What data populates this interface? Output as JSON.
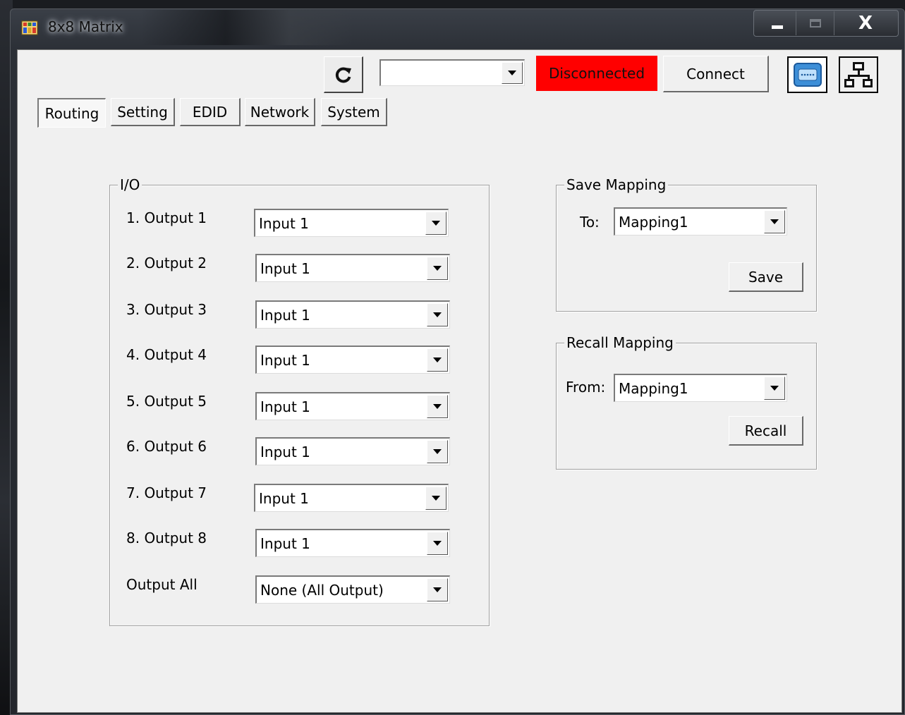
{
  "window": {
    "title": "8x8 Matrix",
    "icons": {
      "app": "matrix-app-icon",
      "minimize": "minimize-icon",
      "maximize": "maximize-icon",
      "close": "close-icon"
    },
    "close_glyph": "X"
  },
  "toolbar": {
    "refresh_icon": "refresh-icon",
    "port_value": "",
    "status_text": "Disconnected",
    "status_color": "#ff0000",
    "connect_label": "Connect",
    "serial_icon": "serial-port-icon",
    "network_icon": "network-icon"
  },
  "tabs": [
    {
      "label": "Routing",
      "selected": true
    },
    {
      "label": "Setting",
      "selected": false
    },
    {
      "label": "EDID",
      "selected": false
    },
    {
      "label": "Network",
      "selected": false
    },
    {
      "label": "System",
      "selected": false
    }
  ],
  "io": {
    "legend": "I/O",
    "rows": [
      {
        "label": "1.  Output 1",
        "value": "Input 1"
      },
      {
        "label": "2.  Output 2",
        "value": "Input 1"
      },
      {
        "label": "3.  Output 3",
        "value": "Input 1"
      },
      {
        "label": "4.  Output 4",
        "value": "Input 1"
      },
      {
        "label": "5.  Output 5",
        "value": "Input 1"
      },
      {
        "label": "6.  Output 6",
        "value": "Input 1"
      },
      {
        "label": "7.  Output 7",
        "value": "Input 1"
      },
      {
        "label": "8.  Output 8",
        "value": "Input 1"
      },
      {
        "label": "Output All",
        "value": "None (All Output)"
      }
    ]
  },
  "save_mapping": {
    "legend": "Save Mapping",
    "to_label": "To:",
    "value": "Mapping1",
    "button": "Save"
  },
  "recall_mapping": {
    "legend": "Recall Mapping",
    "from_label": "From:",
    "value": "Mapping1",
    "button": "Recall"
  }
}
